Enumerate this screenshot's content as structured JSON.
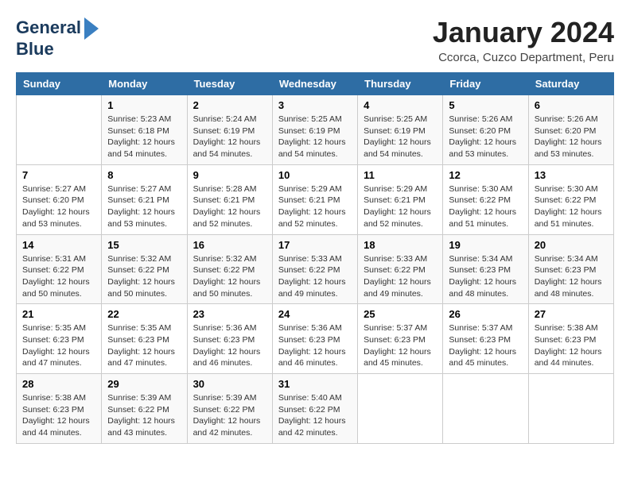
{
  "logo": {
    "line1": "General",
    "line2": "Blue"
  },
  "title": "January 2024",
  "subtitle": "Ccorca, Cuzco Department, Peru",
  "days_of_week": [
    "Sunday",
    "Monday",
    "Tuesday",
    "Wednesday",
    "Thursday",
    "Friday",
    "Saturday"
  ],
  "weeks": [
    [
      {
        "day": "",
        "sunrise": "",
        "sunset": "",
        "daylight": ""
      },
      {
        "day": "1",
        "sunrise": "Sunrise: 5:23 AM",
        "sunset": "Sunset: 6:18 PM",
        "daylight": "Daylight: 12 hours and 54 minutes."
      },
      {
        "day": "2",
        "sunrise": "Sunrise: 5:24 AM",
        "sunset": "Sunset: 6:19 PM",
        "daylight": "Daylight: 12 hours and 54 minutes."
      },
      {
        "day": "3",
        "sunrise": "Sunrise: 5:25 AM",
        "sunset": "Sunset: 6:19 PM",
        "daylight": "Daylight: 12 hours and 54 minutes."
      },
      {
        "day": "4",
        "sunrise": "Sunrise: 5:25 AM",
        "sunset": "Sunset: 6:19 PM",
        "daylight": "Daylight: 12 hours and 54 minutes."
      },
      {
        "day": "5",
        "sunrise": "Sunrise: 5:26 AM",
        "sunset": "Sunset: 6:20 PM",
        "daylight": "Daylight: 12 hours and 53 minutes."
      },
      {
        "day": "6",
        "sunrise": "Sunrise: 5:26 AM",
        "sunset": "Sunset: 6:20 PM",
        "daylight": "Daylight: 12 hours and 53 minutes."
      }
    ],
    [
      {
        "day": "7",
        "sunrise": "Sunrise: 5:27 AM",
        "sunset": "Sunset: 6:20 PM",
        "daylight": "Daylight: 12 hours and 53 minutes."
      },
      {
        "day": "8",
        "sunrise": "Sunrise: 5:27 AM",
        "sunset": "Sunset: 6:21 PM",
        "daylight": "Daylight: 12 hours and 53 minutes."
      },
      {
        "day": "9",
        "sunrise": "Sunrise: 5:28 AM",
        "sunset": "Sunset: 6:21 PM",
        "daylight": "Daylight: 12 hours and 52 minutes."
      },
      {
        "day": "10",
        "sunrise": "Sunrise: 5:29 AM",
        "sunset": "Sunset: 6:21 PM",
        "daylight": "Daylight: 12 hours and 52 minutes."
      },
      {
        "day": "11",
        "sunrise": "Sunrise: 5:29 AM",
        "sunset": "Sunset: 6:21 PM",
        "daylight": "Daylight: 12 hours and 52 minutes."
      },
      {
        "day": "12",
        "sunrise": "Sunrise: 5:30 AM",
        "sunset": "Sunset: 6:22 PM",
        "daylight": "Daylight: 12 hours and 51 minutes."
      },
      {
        "day": "13",
        "sunrise": "Sunrise: 5:30 AM",
        "sunset": "Sunset: 6:22 PM",
        "daylight": "Daylight: 12 hours and 51 minutes."
      }
    ],
    [
      {
        "day": "14",
        "sunrise": "Sunrise: 5:31 AM",
        "sunset": "Sunset: 6:22 PM",
        "daylight": "Daylight: 12 hours and 50 minutes."
      },
      {
        "day": "15",
        "sunrise": "Sunrise: 5:32 AM",
        "sunset": "Sunset: 6:22 PM",
        "daylight": "Daylight: 12 hours and 50 minutes."
      },
      {
        "day": "16",
        "sunrise": "Sunrise: 5:32 AM",
        "sunset": "Sunset: 6:22 PM",
        "daylight": "Daylight: 12 hours and 50 minutes."
      },
      {
        "day": "17",
        "sunrise": "Sunrise: 5:33 AM",
        "sunset": "Sunset: 6:22 PM",
        "daylight": "Daylight: 12 hours and 49 minutes."
      },
      {
        "day": "18",
        "sunrise": "Sunrise: 5:33 AM",
        "sunset": "Sunset: 6:22 PM",
        "daylight": "Daylight: 12 hours and 49 minutes."
      },
      {
        "day": "19",
        "sunrise": "Sunrise: 5:34 AM",
        "sunset": "Sunset: 6:23 PM",
        "daylight": "Daylight: 12 hours and 48 minutes."
      },
      {
        "day": "20",
        "sunrise": "Sunrise: 5:34 AM",
        "sunset": "Sunset: 6:23 PM",
        "daylight": "Daylight: 12 hours and 48 minutes."
      }
    ],
    [
      {
        "day": "21",
        "sunrise": "Sunrise: 5:35 AM",
        "sunset": "Sunset: 6:23 PM",
        "daylight": "Daylight: 12 hours and 47 minutes."
      },
      {
        "day": "22",
        "sunrise": "Sunrise: 5:35 AM",
        "sunset": "Sunset: 6:23 PM",
        "daylight": "Daylight: 12 hours and 47 minutes."
      },
      {
        "day": "23",
        "sunrise": "Sunrise: 5:36 AM",
        "sunset": "Sunset: 6:23 PM",
        "daylight": "Daylight: 12 hours and 46 minutes."
      },
      {
        "day": "24",
        "sunrise": "Sunrise: 5:36 AM",
        "sunset": "Sunset: 6:23 PM",
        "daylight": "Daylight: 12 hours and 46 minutes."
      },
      {
        "day": "25",
        "sunrise": "Sunrise: 5:37 AM",
        "sunset": "Sunset: 6:23 PM",
        "daylight": "Daylight: 12 hours and 45 minutes."
      },
      {
        "day": "26",
        "sunrise": "Sunrise: 5:37 AM",
        "sunset": "Sunset: 6:23 PM",
        "daylight": "Daylight: 12 hours and 45 minutes."
      },
      {
        "day": "27",
        "sunrise": "Sunrise: 5:38 AM",
        "sunset": "Sunset: 6:23 PM",
        "daylight": "Daylight: 12 hours and 44 minutes."
      }
    ],
    [
      {
        "day": "28",
        "sunrise": "Sunrise: 5:38 AM",
        "sunset": "Sunset: 6:23 PM",
        "daylight": "Daylight: 12 hours and 44 minutes."
      },
      {
        "day": "29",
        "sunrise": "Sunrise: 5:39 AM",
        "sunset": "Sunset: 6:22 PM",
        "daylight": "Daylight: 12 hours and 43 minutes."
      },
      {
        "day": "30",
        "sunrise": "Sunrise: 5:39 AM",
        "sunset": "Sunset: 6:22 PM",
        "daylight": "Daylight: 12 hours and 42 minutes."
      },
      {
        "day": "31",
        "sunrise": "Sunrise: 5:40 AM",
        "sunset": "Sunset: 6:22 PM",
        "daylight": "Daylight: 12 hours and 42 minutes."
      },
      {
        "day": "",
        "sunrise": "",
        "sunset": "",
        "daylight": ""
      },
      {
        "day": "",
        "sunrise": "",
        "sunset": "",
        "daylight": ""
      },
      {
        "day": "",
        "sunrise": "",
        "sunset": "",
        "daylight": ""
      }
    ]
  ]
}
